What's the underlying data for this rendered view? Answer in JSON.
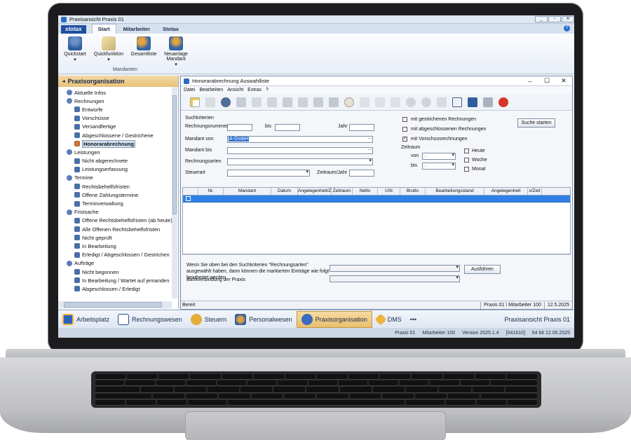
{
  "window": {
    "title": "Praxisansicht Praxis 01",
    "min": "_",
    "max": "▫",
    "close": "✕"
  },
  "ribbon": {
    "logo": "stotax",
    "tabs": [
      "Start",
      "Mitarbeiter",
      "Stotax"
    ],
    "help": "?",
    "buttons": [
      {
        "label": "Quickstart",
        "arrow": "▾"
      },
      {
        "label": "Quickfunktion",
        "arrow": "▾"
      },
      {
        "label": "Gesamtliste",
        "arrow": ""
      },
      {
        "label": "Neuanlage Mandant",
        "arrow": "▾"
      }
    ],
    "group": "Mandanten"
  },
  "leftpanel": {
    "title": "Praxisorganisation",
    "items": [
      {
        "label": "Aktuelle Infos",
        "level": 0
      },
      {
        "label": "Rechnungen",
        "level": 0
      },
      {
        "label": "Entwürfe",
        "level": 1
      },
      {
        "label": "Vorschüsse",
        "level": 1
      },
      {
        "label": "Versandfertige",
        "level": 1
      },
      {
        "label": "Abgeschlossene / Gestrichene",
        "level": 1
      },
      {
        "label": "Honorarabrechnung",
        "level": 1,
        "selected": true
      },
      {
        "label": "Leistungen",
        "level": 0
      },
      {
        "label": "Nicht abgerechnete",
        "level": 1
      },
      {
        "label": "Leistungserfassung",
        "level": 1
      },
      {
        "label": "Termine",
        "level": 0
      },
      {
        "label": "Rechtsbehelfsfristen",
        "level": 1
      },
      {
        "label": "Offene Zahlungstermine",
        "level": 1
      },
      {
        "label": "Terminverwaltung",
        "level": 1
      },
      {
        "label": "Fristsache",
        "level": 0
      },
      {
        "label": "Offene Rechtsbehelfsfristen (ab heute)",
        "level": 1
      },
      {
        "label": "Alle Offenen Rechtsbehelfsfristen",
        "level": 1
      },
      {
        "label": "Nicht geprüft",
        "level": 1
      },
      {
        "label": "In Bearbeitung",
        "level": 1
      },
      {
        "label": "Erledigt / Abgeschlossen / Gestrichen",
        "level": 1
      },
      {
        "label": "Aufträge",
        "level": 0
      },
      {
        "label": "Nicht begonnen",
        "level": 1
      },
      {
        "label": "In Bearbeitung / Wartet auf jemanden",
        "level": 1
      },
      {
        "label": "Abgeschlossen / Erledigt",
        "level": 1
      }
    ]
  },
  "inner": {
    "title": "Honorarabrechnung Auswahlliste",
    "menu": [
      "Datei",
      "Bearbeiten",
      "Ansicht",
      "Extras",
      "?"
    ],
    "criteria": {
      "section": "Suchkriterien",
      "rechnungsnummer": "Rechnungsnummer",
      "bis": "bis",
      "jahr": "Jahr",
      "mandant_von": "Mandant von",
      "mandant_von_value": "A-GmbH",
      "mandant_bis": "Mandant bis",
      "rechnungsarten": "Rechnungsarten",
      "steuerart": "Steuerart",
      "zeitraum_jahr": "Zeitraum/Jahr",
      "ellipsis": "...",
      "mit_gestrichenen": "mit gestrichenen Rechnungen",
      "mit_abgeschlossenen": "mit abgeschlossenen Rechnungen",
      "mit_vorschuss": "mit Vorschussrechnungen",
      "zeitraum": "Zeitraum",
      "von": "von",
      "bis2": "bis",
      "date_placeholder": ". .",
      "heute": "Heute",
      "woche": "Woche",
      "monat": "Monat",
      "suche_starten": "Suche starten"
    },
    "grid": {
      "columns": [
        "",
        "Nr.",
        "Mandant",
        "Datum",
        "Angelegenheit/Zeitraum",
        "Zeitraum",
        "Netto",
        "USt",
        "Brutto",
        "Bearbeitungsstand",
        "Angelegenheit",
        "v/Zeit"
      ]
    },
    "bottom": {
      "hint": "Wenn Sie oben bei den Suchkriterien \"Rechnungsarten\" ausgewählt haben, dann können die markierten Einträge wie folgt bearbeitet werden",
      "bank": "Bankverbindung der Praxis",
      "ausfuehren": "Ausführen"
    },
    "status": {
      "left": "Bereit",
      "praxis": "Praxis 01 \\ Mitarbeiter 100",
      "date": "12.5.2025"
    }
  },
  "navbar": {
    "items": [
      "Arbeitsplatz",
      "Rechnungswesen",
      "Steuern",
      "Personalwesen",
      "Praxisorganisation",
      "DMS",
      "•••"
    ],
    "active": "Praxisorganisation",
    "right": "Praxisansicht Praxis 01"
  },
  "footer": {
    "praxis": "Praxis 01",
    "mitarbeiter": "Mitarbeiter 100",
    "version": "Version 2025.1.4",
    "build": "[041610]",
    "bit": "64 bit 12.05.2025"
  }
}
